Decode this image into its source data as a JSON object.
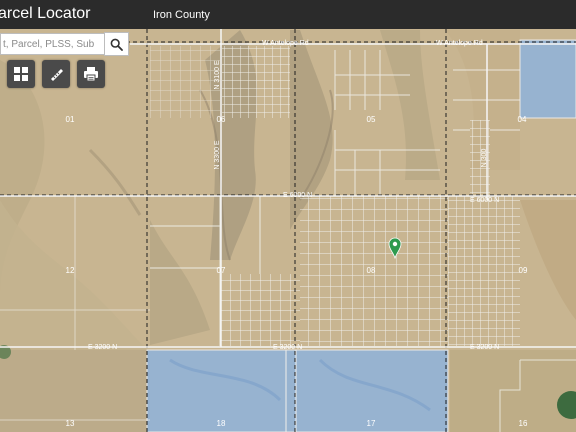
{
  "header": {
    "title": "arcel Locator",
    "county": "Iron County"
  },
  "search": {
    "placeholder": "t, Parcel, PLSS, Sub",
    "value": ""
  },
  "toolbar": {
    "icons": [
      "grid-icon",
      "ruler-icon",
      "print-icon"
    ]
  },
  "map": {
    "sections": [
      "01",
      "06",
      "05",
      "04",
      "12",
      "07",
      "08",
      "09",
      "13",
      "18",
      "17",
      "16"
    ],
    "roads": {
      "antelope_left": "W Antelope Rd",
      "antelope_right": "W Antelope Rd",
      "n3100e": "N 3100 E",
      "n3300e": "N 3300 E",
      "e6000n_center": "E 6000 N",
      "e6000n_right": "E 6000 N",
      "n_short": "N 300",
      "e3200n_left": "E 3200 N",
      "e3200n_center": "E 3200 N",
      "e3200n_right": "E 3200 N"
    },
    "colors": {
      "header": "#2b2b2b",
      "public_land": "#8fb3dc",
      "parcel_line": "#f2f2f2",
      "marker": "#2e9a4f"
    }
  }
}
